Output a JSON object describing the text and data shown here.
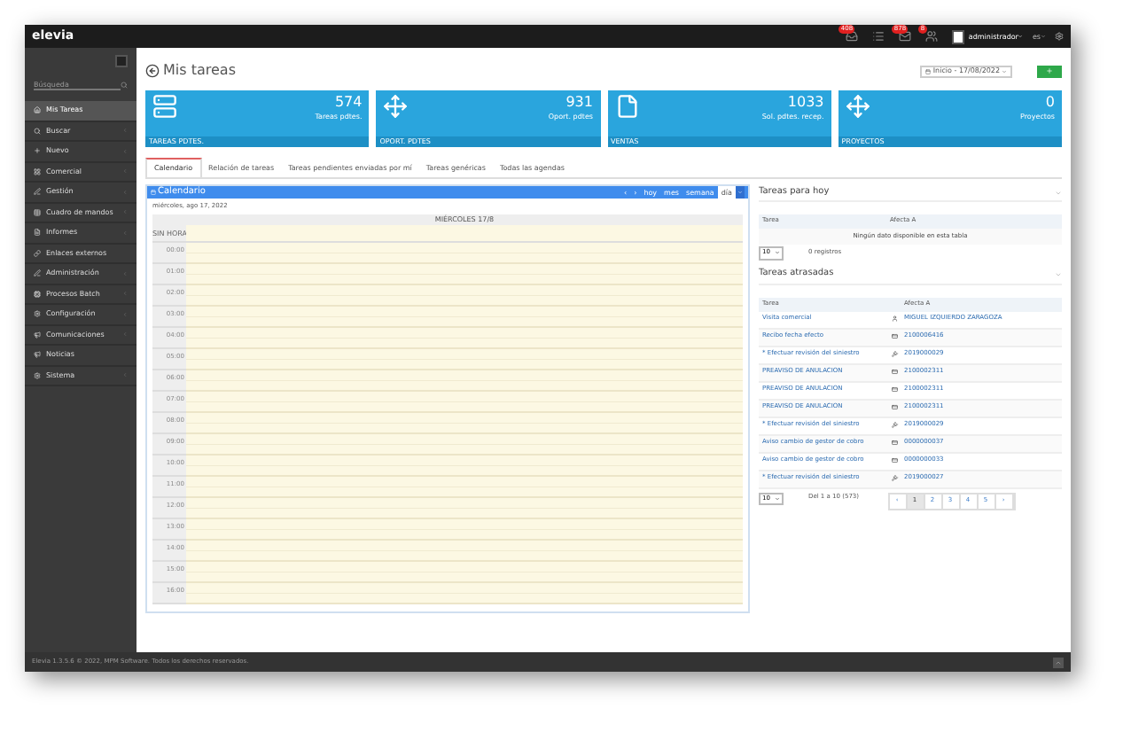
{
  "topbar": {
    "logo": "elevia",
    "notifications": [
      {
        "count": "408",
        "kind": "inbox"
      },
      {
        "kind": "list"
      },
      {
        "count": "878",
        "kind": "mail"
      },
      {
        "count": "8",
        "kind": "users"
      }
    ],
    "user": "administrador",
    "language": "es"
  },
  "sidebar": {
    "search": {
      "placeholder": "Búsqueda"
    },
    "items": [
      {
        "label": "Mis Tareas",
        "selected": true,
        "has_children": false
      },
      {
        "label": "Buscar",
        "selected": false,
        "has_children": true
      },
      {
        "label": "Nuevo",
        "selected": false,
        "has_children": true
      },
      {
        "label": "Comercial",
        "selected": false,
        "has_children": true
      },
      {
        "label": "Gestión",
        "selected": false,
        "has_children": true
      },
      {
        "label": "Cuadro de mandos",
        "selected": false,
        "has_children": true
      },
      {
        "label": "Informes",
        "selected": false,
        "has_children": true
      },
      {
        "label": "Enlaces externos",
        "selected": false,
        "has_children": false
      },
      {
        "label": "Administración",
        "selected": false,
        "has_children": true
      },
      {
        "label": "Procesos Batch",
        "selected": false,
        "has_children": true
      },
      {
        "label": "Configuración",
        "selected": false,
        "has_children": true
      },
      {
        "label": "Comunicaciones",
        "selected": false,
        "has_children": true
      },
      {
        "label": "Noticias",
        "selected": false,
        "has_children": false
      },
      {
        "label": "Sistema",
        "selected": false,
        "has_children": true
      }
    ]
  },
  "page": {
    "title": "Mis tareas",
    "date_range": "Inicio - 17/08/2022"
  },
  "stats": [
    {
      "value": "574",
      "label": "Tareas pdtes.",
      "footer": "TAREAS PDTES.",
      "kind": "server"
    },
    {
      "value": "931",
      "label": "Oport. pdtes",
      "footer": "OPORT. PDTES",
      "kind": "target"
    },
    {
      "value": "1033",
      "label": "Sol. pdtes. recep.",
      "footer": "VENTAS",
      "kind": "file"
    },
    {
      "value": "0",
      "label": "Proyectos",
      "footer": "PROYECTOS",
      "kind": "target"
    }
  ],
  "tabs": [
    {
      "label": "Calendario",
      "selected": true
    },
    {
      "label": "Relación de tareas",
      "selected": false
    },
    {
      "label": "Tareas pendientes enviadas por mí",
      "selected": false
    },
    {
      "label": "Tareas genéricas",
      "selected": false
    },
    {
      "label": "Todas las agendas",
      "selected": false
    }
  ],
  "calendar": {
    "title": "Calendario",
    "nav": [
      {
        "label": "‹",
        "selected": false
      },
      {
        "label": "›",
        "selected": false
      },
      {
        "label": "hoy",
        "selected": false
      },
      {
        "label": "mes",
        "selected": false
      },
      {
        "label": "semana",
        "selected": false
      },
      {
        "label": "día",
        "selected": true
      }
    ],
    "date": "miércoles, ago 17, 2022",
    "day_header": "MIÉRCOLES 17/8",
    "all_day": "SIN HORA",
    "hours": [
      "00:00",
      "01:00",
      "02:00",
      "03:00",
      "04:00",
      "05:00",
      "06:00",
      "07:00",
      "08:00",
      "09:00",
      "10:00",
      "11:00",
      "12:00",
      "13:00",
      "14:00",
      "15:00",
      "16:00"
    ]
  },
  "today": {
    "title": "Tareas para hoy",
    "columns": [
      "Tarea",
      "Afecta A"
    ],
    "empty": "Ningún dato disponible en esta tabla",
    "page_size": "10",
    "count": "0 registros"
  },
  "overdue": {
    "title": "Tareas atrasadas",
    "columns": [
      "Tarea",
      "Afecta A"
    ],
    "rows": [
      {
        "task": "Visita comercial",
        "kind": "person",
        "target": "MIGUEL IZQUIERDO ZARAGOZA"
      },
      {
        "task": "Recibo fecha efecto",
        "kind": "card",
        "target": "2100006416"
      },
      {
        "task": "* Efectuar revisión del siniestro",
        "kind": "gavel",
        "target": "2019000029"
      },
      {
        "task": "PREAVISO DE ANULACION",
        "kind": "card",
        "target": "2100002311"
      },
      {
        "task": "PREAVISO DE ANULACION",
        "kind": "card",
        "target": "2100002311"
      },
      {
        "task": "PREAVISO DE ANULACION",
        "kind": "card",
        "target": "2100002311"
      },
      {
        "task": "* Efectuar revisión del siniestro",
        "kind": "gavel",
        "target": "2019000029"
      },
      {
        "task": "Aviso cambio de gestor de cobro",
        "kind": "card",
        "target": "0000000037"
      },
      {
        "task": "Aviso cambio de gestor de cobro",
        "kind": "card",
        "target": "0000000033"
      },
      {
        "task": "* Efectuar revisión del siniestro",
        "kind": "gavel",
        "target": "2019000027"
      }
    ],
    "page_size": "10",
    "summary": "Del 1 a 10 (573)",
    "pages": [
      {
        "label": "‹",
        "selected": false
      },
      {
        "label": "1",
        "selected": true
      },
      {
        "label": "2",
        "selected": false
      },
      {
        "label": "3",
        "selected": false
      },
      {
        "label": "4",
        "selected": false
      },
      {
        "label": "5",
        "selected": false
      },
      {
        "label": "›",
        "selected": false
      }
    ]
  },
  "footer": "Elevia 1.3.5.6 © 2022, MPM Software. Todos los derechos reservados."
}
